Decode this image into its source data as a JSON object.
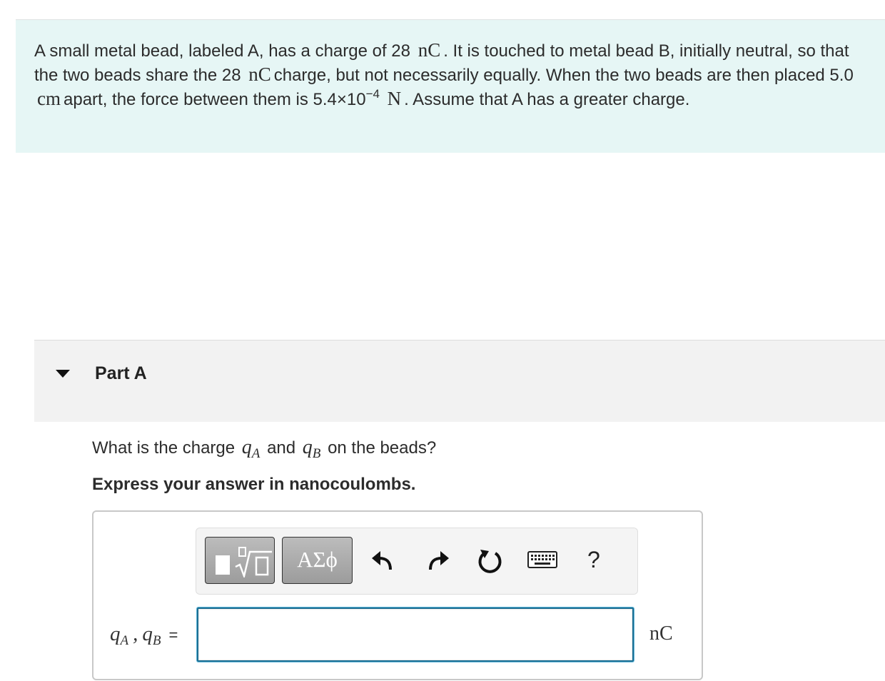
{
  "problem": {
    "t1": "A small metal bead, labeled A, has a charge of 28",
    "u1": "nC",
    "t2": ". It is touched to metal bead B, initially neutral, so that the two beads share the 28",
    "u2": "nC",
    "t3": "charge, but not necessarily equally. When the two beads are then placed 5.0",
    "u3": "cm",
    "t4": "apart, the force between them is 5.4×10",
    "exp": "−4",
    "u4": "N",
    "t5": ". Assume that A has a greater charge."
  },
  "part": {
    "title": "Part A"
  },
  "question": {
    "t1": "What is the charge",
    "var_a": "q",
    "sub_a": "A",
    "t2": "and",
    "var_b": "q",
    "sub_b": "B",
    "t3": "on the beads?"
  },
  "instruction": "Express your answer in nanocoulombs.",
  "toolbar": {
    "symbols_label": "ΑΣϕ",
    "help_label": "?",
    "icons": [
      "templates-icon",
      "symbols-icon",
      "undo-icon",
      "redo-icon",
      "reset-icon",
      "keyboard-icon",
      "help-icon"
    ]
  },
  "answer": {
    "var_a": "q",
    "sub_a": "A",
    "sep": ",",
    "var_b": "q",
    "sub_b": "B",
    "equals": "=",
    "value": "",
    "unit": "nC"
  },
  "colors": {
    "problem_bg": "#e6f6f5",
    "part_header_bg": "#f2f2f2",
    "input_border": "#1c6f93",
    "toolbar_bg": "#f4f4f4"
  }
}
